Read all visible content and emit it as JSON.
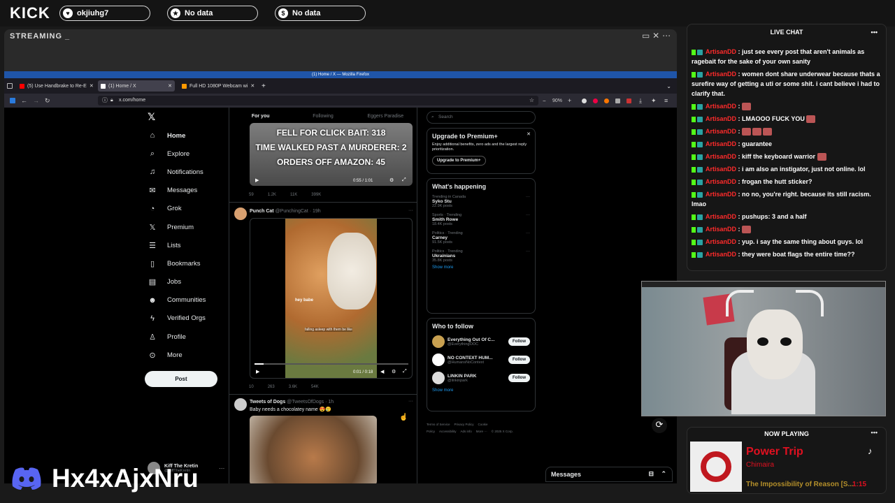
{
  "topbar": {
    "brand": "KICK",
    "pills": [
      {
        "icon": "heart-icon",
        "label": "okjiuhg7"
      },
      {
        "icon": "star-icon",
        "label": "No data"
      },
      {
        "icon": "dollar-icon",
        "label": "No data"
      }
    ]
  },
  "stream": {
    "title": "STREAMING _"
  },
  "firefox": {
    "window_title": "(1) Home / X — Mozilla Firefox",
    "tabs": [
      {
        "label": "(5) Use Handbrake to Re-E",
        "fav_color": "#ff0000"
      },
      {
        "label": "(1) Home / X",
        "fav_color": "#ffffff"
      },
      {
        "label": "Full HD 1080P Webcam wi",
        "fav_color": "#ff9900"
      }
    ],
    "url": "x.com/home",
    "zoom": "90%"
  },
  "x": {
    "nav": [
      {
        "icon": "home-icon",
        "label": "Home"
      },
      {
        "icon": "search-icon",
        "label": "Explore"
      },
      {
        "icon": "bell-icon",
        "label": "Notifications"
      },
      {
        "icon": "mail-icon",
        "label": "Messages"
      },
      {
        "icon": "grok-icon",
        "label": "Grok"
      },
      {
        "icon": "x-logo-icon",
        "label": "Premium"
      },
      {
        "icon": "list-icon",
        "label": "Lists"
      },
      {
        "icon": "bookmark-icon",
        "label": "Bookmarks"
      },
      {
        "icon": "briefcase-icon",
        "label": "Jobs"
      },
      {
        "icon": "people-icon",
        "label": "Communities"
      },
      {
        "icon": "lightning-icon",
        "label": "Verified Orgs"
      },
      {
        "icon": "person-icon",
        "label": "Profile"
      },
      {
        "icon": "more-circle-icon",
        "label": "More"
      }
    ],
    "post_button": "Post",
    "account": {
      "name": "Kiff The Kretin",
      "handle": "@KiffTheKretin"
    },
    "feed_tabs": [
      "For you",
      "Following",
      "Eggers Paradise"
    ],
    "tweet1": {
      "caption_lines": [
        "FELL FOR CLICK BAIT: 318",
        "TIME WALKED PAST A MURDERER: 2",
        "ORDERS OFF AMAZON: 45"
      ],
      "time": "0:55 / 1:01",
      "stats": [
        "59",
        "1.2K",
        "11K",
        "399K"
      ]
    },
    "tweet2": {
      "name": "Punch Cat",
      "handle": "@PunchingCat · 19h",
      "overlay1": "hey babe",
      "overlay2": "falling asleep with them be like",
      "time": "0:01 / 0:18",
      "stats": [
        "10",
        "263",
        "3.6K",
        "54K"
      ]
    },
    "tweet3": {
      "name": "Tweets of Dogs",
      "handle": "@TweetsOfDogs · 1h",
      "text": "Baby needs a chocolatey name 😍🥲"
    },
    "search_placeholder": "Search",
    "premium": {
      "title": "Upgrade to Premium+",
      "text": "Enjoy additional benefits, zero ads and the largest reply prioritization.",
      "button": "Upgrade to Premium+"
    },
    "happening": {
      "title": "What's happening",
      "trends": [
        {
          "context": "Trending in Canada",
          "name": "Syko Stu",
          "posts": "22.9K posts"
        },
        {
          "context": "Sports · Trending",
          "name": "Smith Rowe",
          "posts": "18.4K posts"
        },
        {
          "context": "Politics · Trending",
          "name": "Carney",
          "posts": "91.5K posts"
        },
        {
          "context": "Politics · Trending",
          "name": "Ukrainians",
          "posts": "35.8K posts"
        }
      ],
      "show_more": "Show more"
    },
    "who_to_follow": {
      "title": "Who to follow",
      "accounts": [
        {
          "name": "Everything Out Of C...",
          "handle": "@EverythingOOC"
        },
        {
          "name": "NO CONTEXT HUM...",
          "handle": "@HumansNoContext"
        },
        {
          "name": "LINKIN PARK",
          "handle": "@linkinpark"
        }
      ],
      "follow_label": "Follow",
      "show_more": "Show more"
    },
    "footer": [
      "Terms of Service",
      "Privacy Policy",
      "Cookie Policy",
      "Accessibility",
      "Ads info",
      "More ···",
      "© 2025 X Corp."
    ],
    "messages_drawer": "Messages"
  },
  "chat": {
    "title": "LIVE CHAT",
    "messages": [
      {
        "user": "ArtisanDD",
        "text": "just see every post that aren't animals as ragebait for the sake of your own sanity",
        "emotes": 0
      },
      {
        "user": "ArtisanDD",
        "text": "women dont share underwear because thats a surefire way of getting a uti or some shit. i cant believe i had to clarify that.",
        "emotes": 0
      },
      {
        "user": "ArtisanDD",
        "text": "",
        "emotes": 1
      },
      {
        "user": "ArtisanDD",
        "text": "LMAOOO FUCK YOU",
        "emotes": 1
      },
      {
        "user": "ArtisanDD",
        "text": "",
        "emotes": 3
      },
      {
        "user": "ArtisanDD",
        "text": "guarantee",
        "emotes": 0
      },
      {
        "user": "ArtisanDD",
        "text": "kiff the keyboard warrior",
        "emotes": 1
      },
      {
        "user": "ArtisanDD",
        "text": "i am also an instigator, just not online. lol",
        "emotes": 0
      },
      {
        "user": "ArtisanDD",
        "text": "frogan the hutt sticker?",
        "emotes": 0
      },
      {
        "user": "ArtisanDD",
        "text": "no no, you're right. because its still racism. lmao",
        "emotes": 0
      },
      {
        "user": "ArtisanDD",
        "text": "pushups: 3 and a half",
        "emotes": 0
      },
      {
        "user": "ArtisanDD",
        "text": "",
        "emotes": 1
      },
      {
        "user": "ArtisanDD",
        "text": "yup. i say the same thing about guys. lol",
        "emotes": 0
      },
      {
        "user": "ArtisanDD",
        "text": "they were boat flags the entire time??",
        "emotes": 0
      }
    ]
  },
  "now_playing": {
    "title": "NOW PLAYING",
    "song": "Power Trip",
    "artist": "Chimaira",
    "album": "The Impossibility of Reason [S...",
    "time": "1:15"
  },
  "discord": {
    "code": "Hx4xAjxNru"
  },
  "colors": {
    "kick_green": "#53fc18",
    "chat_user": "#ff2b2b",
    "x_blue": "#1d9bf0"
  }
}
